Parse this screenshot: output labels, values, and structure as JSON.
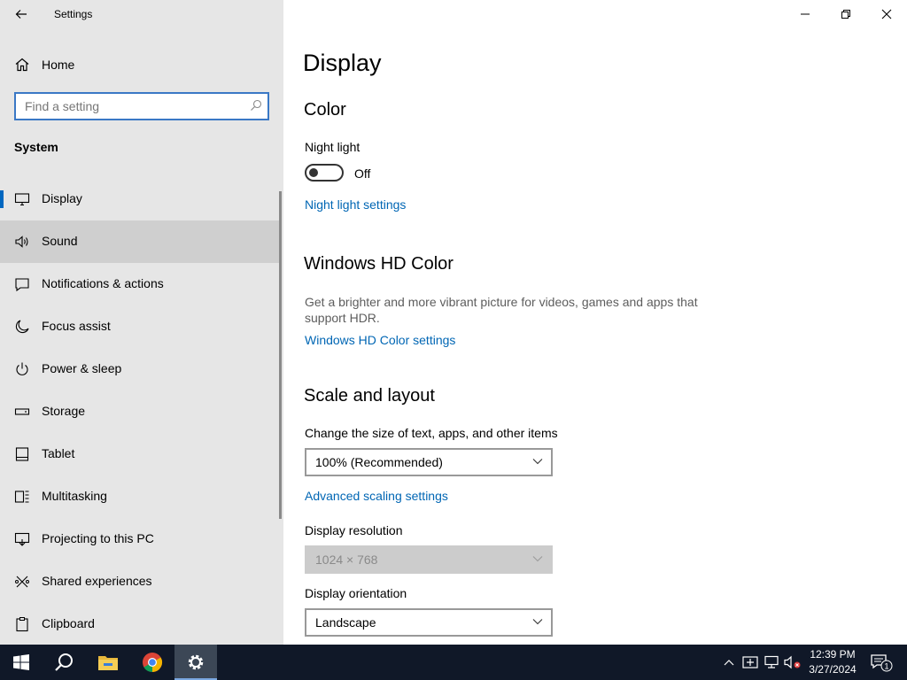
{
  "window": {
    "title": "Settings"
  },
  "sidebar": {
    "home_label": "Home",
    "search_placeholder": "Find a setting",
    "section_label": "System",
    "items": [
      {
        "label": "Display",
        "icon": "monitor-icon",
        "selected": true
      },
      {
        "label": "Sound",
        "icon": "speaker-icon",
        "hover": true
      },
      {
        "label": "Notifications & actions",
        "icon": "notification-icon"
      },
      {
        "label": "Focus assist",
        "icon": "moon-icon"
      },
      {
        "label": "Power & sleep",
        "icon": "power-icon"
      },
      {
        "label": "Storage",
        "icon": "storage-icon"
      },
      {
        "label": "Tablet",
        "icon": "tablet-icon"
      },
      {
        "label": "Multitasking",
        "icon": "multitasking-icon"
      },
      {
        "label": "Projecting to this PC",
        "icon": "projecting-icon"
      },
      {
        "label": "Shared experiences",
        "icon": "shared-icon"
      },
      {
        "label": "Clipboard",
        "icon": "clipboard-icon"
      }
    ]
  },
  "main": {
    "title": "Display",
    "color": {
      "heading": "Color",
      "night_light_label": "Night light",
      "night_light_state": "Off",
      "night_light_link": "Night light settings"
    },
    "hd_color": {
      "heading": "Windows HD Color",
      "description": "Get a brighter and more vibrant picture for videos, games and apps that support HDR.",
      "link": "Windows HD Color settings"
    },
    "scale": {
      "heading": "Scale and layout",
      "size_label": "Change the size of text, apps, and other items",
      "size_value": "100% (Recommended)",
      "advanced_link": "Advanced scaling settings",
      "resolution_label": "Display resolution",
      "resolution_value": "1024 × 768",
      "orientation_label": "Display orientation",
      "orientation_value": "Landscape"
    }
  },
  "taskbar": {
    "time": "12:39 PM",
    "date": "3/27/2024",
    "notification_count": "1"
  },
  "colors": {
    "accent": "#0067c0",
    "link": "#0066b4",
    "sidebar_bg": "#e6e6e6",
    "taskbar_bg": "#101828"
  }
}
